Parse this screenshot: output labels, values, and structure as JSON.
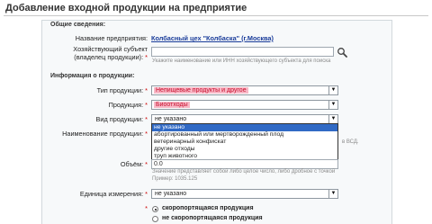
{
  "page_title": "Добавление входной продукции на предприятие",
  "general": {
    "title": "Общие сведения:",
    "org_label": "Название предприятия:",
    "org_value": "Колбасный цех \"Колбаска\" (г.Москва)",
    "owner_label_1": "Хозяйствующий субъект",
    "owner_label_2": "(владелец продукции):",
    "owner_required": "*",
    "owner_value": "",
    "owner_hint": "Укажите наименование или ИНН хозяйствующего субъекта для поиска"
  },
  "product": {
    "title": "Информация о продукции:",
    "type_label": "Тип продукции:",
    "type_value": "Непищевые продукты и другое",
    "product_label": "Продукция:",
    "product_value": "Биоотходы",
    "kind_label": "Вид продукции:",
    "kind_value": "не указано",
    "kind_options": [
      "не указано",
      "абортированный или мертворожденный плод",
      "ветеринарный конфискат",
      "другие отходы",
      "труп животного"
    ],
    "name_label": "Наименование продукции:",
    "name_right_hint": "в ВСД.",
    "volume_label": "Объём:",
    "volume_value": "0.0",
    "volume_hint": "Значение представляет собой либо целое число, либо дробное с точкой",
    "volume_example": "Пример: 1035.125",
    "unit_label": "Единица измерения:",
    "unit_value": "не указано",
    "perishable_options": [
      "скоропортящаяся продукция",
      "не скоропортящаяся продукция"
    ],
    "required": "*"
  }
}
